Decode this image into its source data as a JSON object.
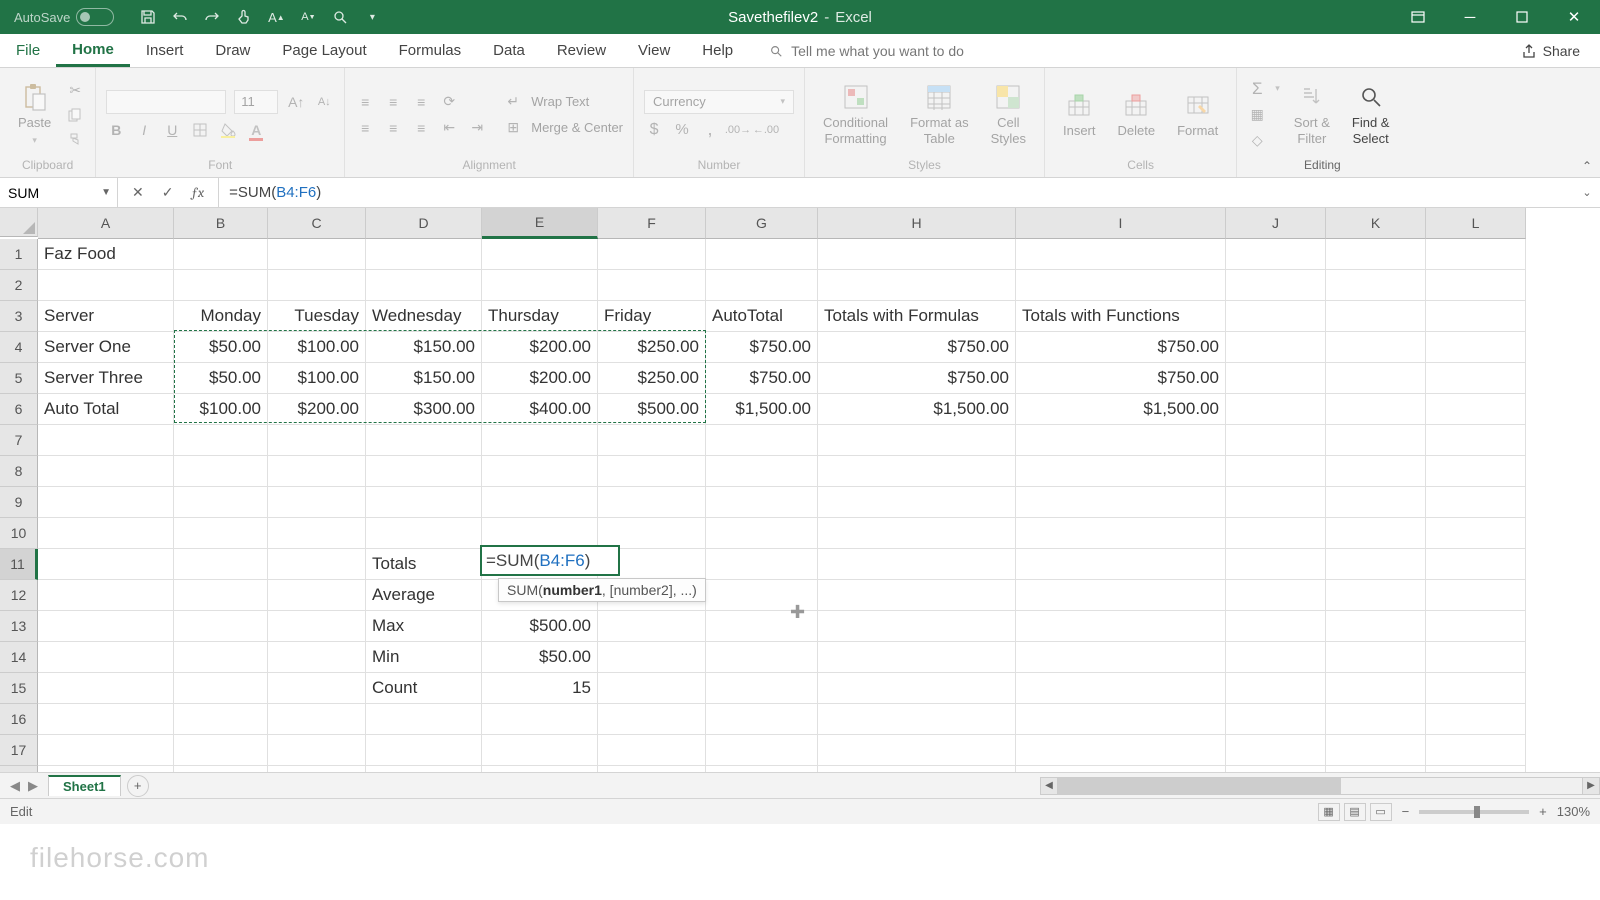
{
  "title": {
    "doc": "Savethefilev2",
    "app": "Excel",
    "autosave": "AutoSave"
  },
  "tabs": {
    "file": "File",
    "home": "Home",
    "insert": "Insert",
    "draw": "Draw",
    "pagelayout": "Page Layout",
    "formulas": "Formulas",
    "data": "Data",
    "review": "Review",
    "view": "View",
    "help": "Help",
    "tellme": "Tell me what you want to do",
    "share": "Share"
  },
  "ribbon": {
    "clipboard": {
      "label": "Clipboard",
      "paste": "Paste"
    },
    "font": {
      "label": "Font",
      "size": "11"
    },
    "alignment": {
      "label": "Alignment",
      "wrap": "Wrap Text",
      "merge": "Merge & Center"
    },
    "number": {
      "label": "Number",
      "format": "Currency"
    },
    "styles": {
      "label": "Styles",
      "cond": "Conditional\nFormatting",
      "fat": "Format as\nTable",
      "cs": "Cell\nStyles"
    },
    "cells": {
      "label": "Cells",
      "insert": "Insert",
      "delete": "Delete",
      "format": "Format"
    },
    "editing": {
      "label": "Editing",
      "sort": "Sort &\nFilter",
      "find": "Find &\nSelect"
    }
  },
  "namebox": "SUM",
  "formula": {
    "prefix": "=SUM(",
    "ref": "B4:F6",
    "suffix": ")"
  },
  "tooltip": {
    "fn": "SUM(",
    "arg": "number1",
    "rest": ", [number2], ...)"
  },
  "headers": [
    "A",
    "B",
    "C",
    "D",
    "E",
    "F",
    "G",
    "H",
    "I",
    "J",
    "K",
    "L"
  ],
  "sheet": {
    "a1": "Faz Food",
    "a3": "Server",
    "b3": "Monday",
    "c3": "Tuesday",
    "d3": "Wednesday",
    "e3": "Thursday",
    "f3": "Friday",
    "g3": "AutoTotal",
    "h3": "Totals with Formulas",
    "i3": "Totals with Functions",
    "a4": "Server One",
    "b4": "$50.00",
    "c4": "$100.00",
    "d4": "$150.00",
    "e4": "$200.00",
    "f4": "$250.00",
    "g4": "$750.00",
    "h4": "$750.00",
    "i4": "$750.00",
    "a5": "Server Three",
    "b5": "$50.00",
    "c5": "$100.00",
    "d5": "$150.00",
    "e5": "$200.00",
    "f5": "$250.00",
    "g5": "$750.00",
    "h5": "$750.00",
    "i5": "$750.00",
    "a6": "Auto Total",
    "b6": "$100.00",
    "c6": "$200.00",
    "d6": "$300.00",
    "e6": "$400.00",
    "f6": "$500.00",
    "g6": "$1,500.00",
    "h6": "$1,500.00",
    "i6": "$1,500.00",
    "d11": "Totals",
    "d12": "Average",
    "d13": "Max",
    "e13": "$500.00",
    "d14": "Min",
    "e14": "$50.00",
    "d15": "Count",
    "e15": "15"
  },
  "sheettab": "Sheet1",
  "status": {
    "mode": "Edit",
    "zoom": "130%"
  },
  "watermark": "filehorse.com"
}
